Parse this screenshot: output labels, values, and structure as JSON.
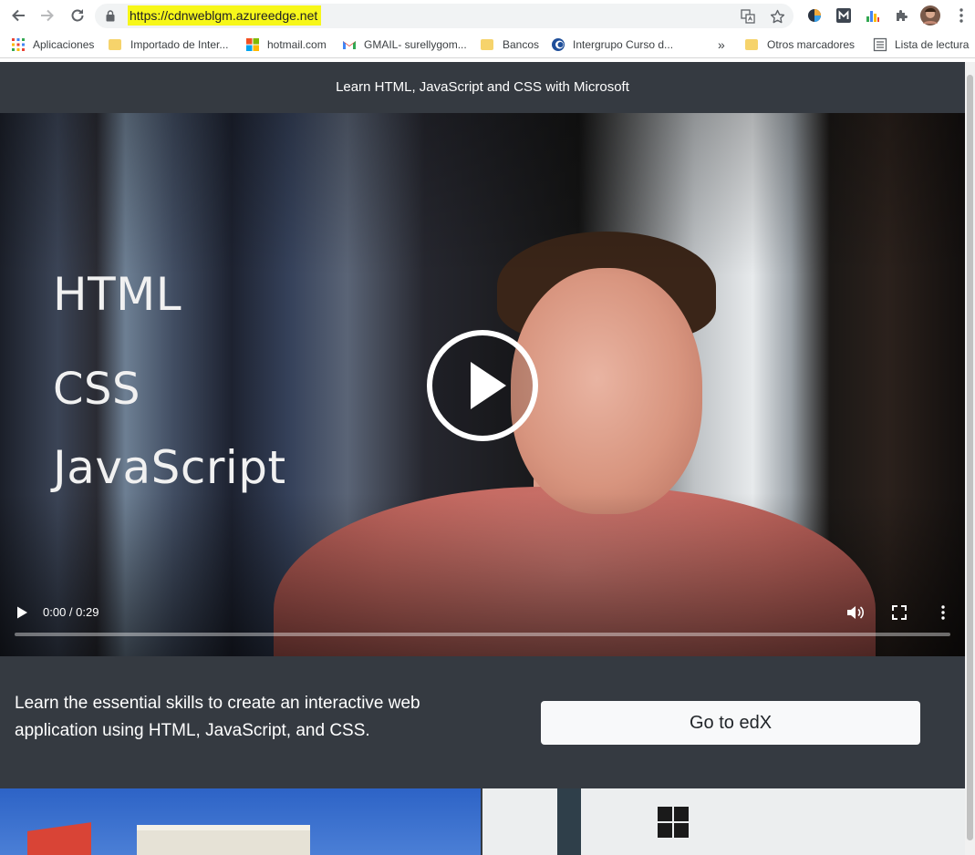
{
  "browser": {
    "url": "https://cdnweblgm.azureedge.net",
    "bookmarks": [
      {
        "label": "Aplicaciones",
        "icon": "apps-grid-icon"
      },
      {
        "label": "Importado de Inter...",
        "icon": "folder-icon"
      },
      {
        "label": "hotmail.com",
        "icon": "microsoft-icon"
      },
      {
        "label": "GMAIL- surellygom...",
        "icon": "gmail-icon"
      },
      {
        "label": "Bancos",
        "icon": "folder-icon"
      },
      {
        "label": "Intergrupo Curso d...",
        "icon": "site-icon"
      },
      {
        "label": "»",
        "icon": "overflow-chevron-icon"
      },
      {
        "label": "Otros marcadores",
        "icon": "folder-icon"
      },
      {
        "label": "Lista de lectura",
        "icon": "reading-list-icon"
      }
    ]
  },
  "page": {
    "title": "Learn HTML, JavaScript and CSS with Microsoft",
    "video": {
      "overlay_lines": [
        "HTML",
        "CSS",
        "JavaScript"
      ],
      "time": "0:00 / 0:29",
      "progress": 0
    },
    "lead": "Learn the essential skills to create an interactive web application using HTML, JavaScript, and CSS.",
    "cta_label": "Go to edX"
  }
}
